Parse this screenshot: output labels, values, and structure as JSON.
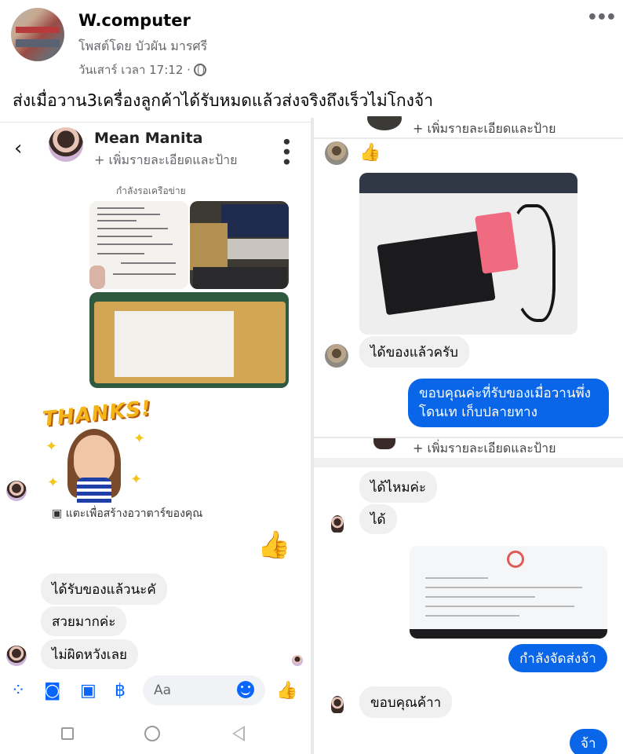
{
  "post": {
    "page_name": "W.computer",
    "posted_by": "โพสต์โดย บัวผัน มารศรี",
    "time": "วันเสาร์ เวลา 17:12 ·",
    "text": "ส่งเมื่อวาน3เครื่องลูกค้าได้รับหมดแล้วส่งจริงถึงเร็วไม่โกงจ้า",
    "more_label": "•••"
  },
  "left_chat": {
    "contact_name": "Mean Manita",
    "contact_sub": "+ เพิ่มรายละเอียดและป้าย",
    "status": "กำลังรอเครือข่าย",
    "sticker_text": "THANKS!",
    "avatar_caption": "แตะเพื่อสร้างอวาตาร์ของคุณ",
    "messages": [
      {
        "text": "ได้รับของแล้วนะคั"
      },
      {
        "text": "สวยมากค่ะ"
      },
      {
        "text": "ไม่ผิดหวังเลย"
      }
    ],
    "input_placeholder": "Aa"
  },
  "right_top_chat": {
    "contact_sub": "+ เพิ่มรายละเอียดและป้าย",
    "received_msg": "ได้ของแล้วครับ",
    "reply_line1": "ขอบคุณค่ะที่รับของเมื่อวานพึ่ง",
    "reply_line2": "โดนเท เก็บปลายทาง"
  },
  "right_bottom_chat": {
    "contact_sub": "+ เพิ่มรายละเอียดและป้าย",
    "msg1": "ได้ไหมค่ะ",
    "msg2": "ได้",
    "sent": "กำลังจัดส่งจ้า",
    "msg3": "ขอบคุณค้าา",
    "sent2": "จ้า"
  },
  "colors": {
    "messenger_blue": "#0866ff",
    "bubble_grey": "#f0f0f0",
    "secondary_text": "#65676b"
  }
}
